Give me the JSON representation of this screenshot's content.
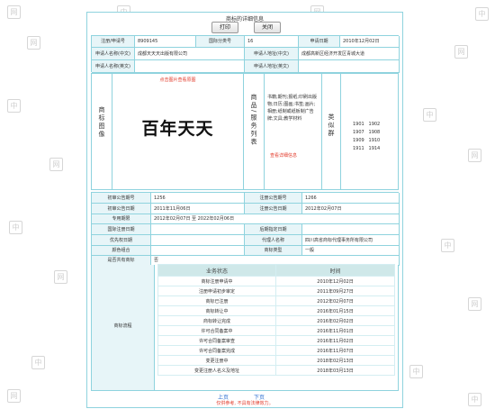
{
  "page": {
    "title": "商标的详细信息",
    "watermark_chars": [
      "中",
      "国",
      "商",
      "标",
      "网"
    ],
    "buttons": {
      "print": "打印",
      "close": "关闭"
    }
  },
  "info_rows": [
    {
      "l1": "注册/申请号",
      "v1": "8909145",
      "l2": "国际分类号",
      "v2": "16",
      "l3": "申请日期",
      "v3": "2010年12月02日"
    },
    {
      "l1": "申请人名称(中文)",
      "v1": "成都天天天出版有限公司",
      "l2": "申请人地址(中文)",
      "v2": "成都高新区经济开发区青城大道"
    },
    {
      "l1": "申请人名称(英文)",
      "v1": "",
      "l2": "申请人地址(英文)",
      "v2": ""
    }
  ],
  "mark": {
    "image_label": "商标图像",
    "red_note": "点击图片查看原图",
    "text": "百年天天",
    "services_label": "商品/服务列表",
    "services_text": "书籍;期刊;报纸;印刷出版物;日历;图画;书签;画片;相册;纸制或纸板制广告牌;文具;教学材料",
    "services_link": "查看详细信息",
    "group_label": "类似群",
    "groups": [
      "1901",
      "1902",
      "1907",
      "1908",
      "1909",
      "1910",
      "1911",
      "1914"
    ]
  },
  "detail_rows": [
    {
      "l1": "初审公告期号",
      "v1": "1256",
      "l2": "注册公告期号",
      "v2": "1266"
    },
    {
      "l1": "初审公告日期",
      "v1": "2011年11月06日",
      "l2": "注册公告日期",
      "v2": "2012年02月07日"
    },
    {
      "l1": "专用期限",
      "v1": "2012年02月07日 至 2022年02月06日"
    },
    {
      "l1": "国际注册日期",
      "v1": "",
      "l2": "后期指定日期",
      "v2": ""
    },
    {
      "l1": "优先权日期",
      "v1": "",
      "l2": "代理人名称",
      "v2": "四川高省商标代理事务所有限公司"
    },
    {
      "l1": "颜色组合",
      "v1": "",
      "l2": "商标类型",
      "v2": "一般"
    },
    {
      "l1": "是否共有商标",
      "v1": "否"
    }
  ],
  "process": {
    "label": "商标流程",
    "headers": [
      "业务状态",
      "时间"
    ],
    "rows": [
      {
        "status": "商标注册申请中",
        "date": "2010年12月02日"
      },
      {
        "status": "注册申请初步审定",
        "date": "2011年09月27日"
      },
      {
        "status": "商标已注册",
        "date": "2012年02月07日"
      },
      {
        "status": "商标转让中",
        "date": "2016年01月15日"
      },
      {
        "status": "商标转让完成",
        "date": "2016年02月02日"
      },
      {
        "status": "许可合同备案中",
        "date": "2016年11月01日"
      },
      {
        "status": "许可合同备案审查",
        "date": "2016年11月02日"
      },
      {
        "status": "许可合同备案完成",
        "date": "2016年11月07日"
      },
      {
        "status": "变更注册中",
        "date": "2018年02月13日"
      },
      {
        "status": "变更注册人名义及地址",
        "date": "2018年03月13日"
      }
    ]
  },
  "pager": {
    "prev": "上页",
    "next": "下页"
  },
  "footer_note": "仅供参考, 不具有法律效力。"
}
